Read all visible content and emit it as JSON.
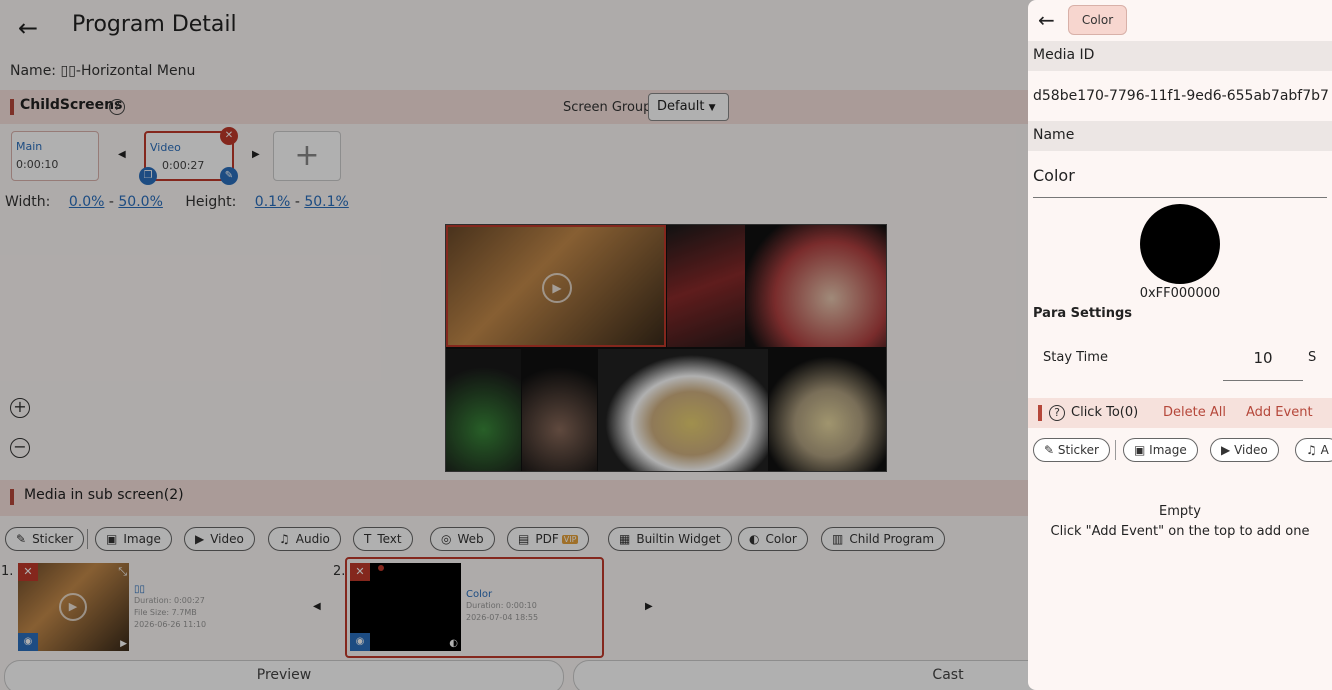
{
  "page": {
    "title": "Program Detail",
    "name_prefix": "Name: ",
    "name_value": "▯▯-Horizontal Menu"
  },
  "child_screens": {
    "title": "ChildScreens",
    "help_icon": "?",
    "screen_group_label": "Screen Group",
    "screen_group_value": "Default",
    "cards": [
      {
        "name": "Main",
        "time": "0:00:10"
      },
      {
        "name": "Video",
        "time": "0:00:27"
      }
    ],
    "add_label": "+",
    "width_label": "Width:",
    "width_from": "0.0%",
    "width_to": "50.0%",
    "height_label": "Height:",
    "height_from": "0.1%",
    "height_to": "50.1%",
    "dash": "-"
  },
  "media": {
    "title": "Media in sub screen(2)",
    "chips": [
      {
        "icon": "✎",
        "label": "Sticker"
      },
      {
        "icon": "▣",
        "label": "Image"
      },
      {
        "icon": "▶",
        "label": "Video"
      },
      {
        "icon": "♫",
        "label": "Audio"
      },
      {
        "icon": "T",
        "label": "Text"
      },
      {
        "icon": "◎",
        "label": "Web"
      },
      {
        "icon": "▤",
        "label": "PDF",
        "badge": "VIP"
      },
      {
        "icon": "▦",
        "label": "Builtin Widget"
      },
      {
        "icon": "◐",
        "label": "Color"
      },
      {
        "icon": "▥",
        "label": "Child Program"
      }
    ],
    "items": [
      {
        "index": "1.",
        "name": "▯▯",
        "duration": "Duration: 0:00:27",
        "size": "File Size: 7.7MB",
        "date": "2026-06-26 11:10"
      },
      {
        "index": "2.",
        "name": "Color",
        "duration": "Duration: 0:00:10",
        "date": "2026-07-04 18:55"
      }
    ]
  },
  "bottom": {
    "preview": "Preview",
    "cast": "Cast"
  },
  "drawer": {
    "back_icon": "←",
    "chip": "Color",
    "media_id_label": "Media ID",
    "media_id_value": "d58be170-7796-11f1-9ed6-655ab7abf7b7",
    "name_label": "Name",
    "name_value": "Color",
    "color_hex": "0xFF000000",
    "color_value": "#000000",
    "para_settings": "Para Settings",
    "stay_time_label": "Stay Time",
    "stay_time_value": "10",
    "stay_time_unit": "S",
    "click_to": "Click To(0)",
    "delete_all": "Delete All",
    "add_event": "Add Event",
    "chips": [
      {
        "icon": "✎",
        "label": "Sticker"
      },
      {
        "icon": "▣",
        "label": "Image"
      },
      {
        "icon": "▶",
        "label": "Video"
      },
      {
        "icon": "♫",
        "label": "A"
      }
    ],
    "empty_title": "Empty",
    "empty_sub": "Click \"Add Event\" on the top to add one"
  },
  "colors": {
    "accent": "#b5473a",
    "link": "#2a6fbd",
    "section_bg": "#f6e1dc"
  }
}
